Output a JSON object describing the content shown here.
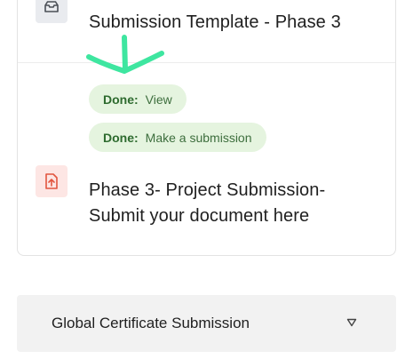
{
  "activities": [
    {
      "title": "Submission Template - Phase 3",
      "icon": "folder-icon",
      "statuses": [
        {
          "done_label": "Done:",
          "action_label": "View"
        },
        {
          "done_label": "Done:",
          "action_label": "Make a submission"
        }
      ]
    },
    {
      "title": "Phase 3- Project Submission- Submit your document here",
      "icon": "upload-file-icon"
    }
  ],
  "accordion": {
    "label": "Global Certificate Submission",
    "icon": "chevron-down-icon"
  },
  "colors": {
    "pill_bg": "#e5f4df",
    "done_text": "#2e6b2f",
    "annotation_arrow": "#3ee6a0",
    "upload_icon": "#e2553f"
  }
}
